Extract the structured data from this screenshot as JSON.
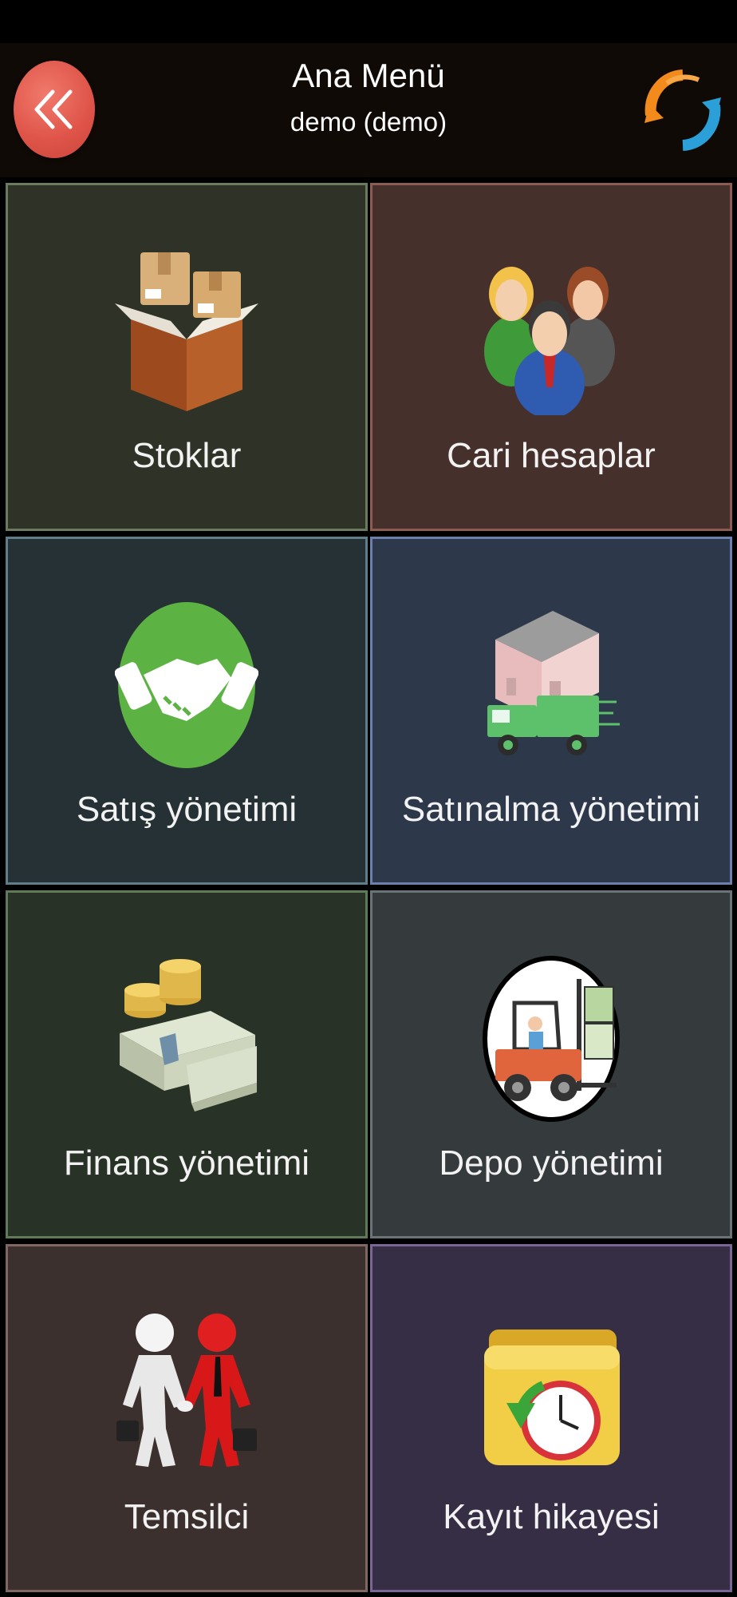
{
  "header": {
    "title": "Ana Menü",
    "subtitle": "demo (demo)",
    "back_icon": "double-chevron-left-icon",
    "refresh_icon": "refresh-icon"
  },
  "menu": {
    "items": [
      {
        "label": "Stoklar",
        "icon": "boxes-icon"
      },
      {
        "label": "Cari hesaplar",
        "icon": "people-icon"
      },
      {
        "label": "Satış yönetimi",
        "icon": "handshake-icon"
      },
      {
        "label": "Satınalma yönetimi",
        "icon": "warehouse-truck-icon"
      },
      {
        "label": "Finans yönetimi",
        "icon": "money-icon"
      },
      {
        "label": "Depo yönetimi",
        "icon": "forklift-icon"
      },
      {
        "label": "Temsilci",
        "icon": "representative-icon"
      },
      {
        "label": "Kayıt hikayesi",
        "icon": "history-folder-icon"
      }
    ]
  },
  "colors": {
    "header_bg": "#0f0a05",
    "back_button": "#e0554a",
    "tile_stoklar": "#2e3227",
    "tile_cari": "#45302c",
    "tile_satis": "#253134",
    "tile_satinalma": "#2e384b",
    "tile_finans": "#293226",
    "tile_depo": "#353a3d",
    "tile_temsilci": "#3c302f",
    "tile_kayit": "#362e44"
  }
}
